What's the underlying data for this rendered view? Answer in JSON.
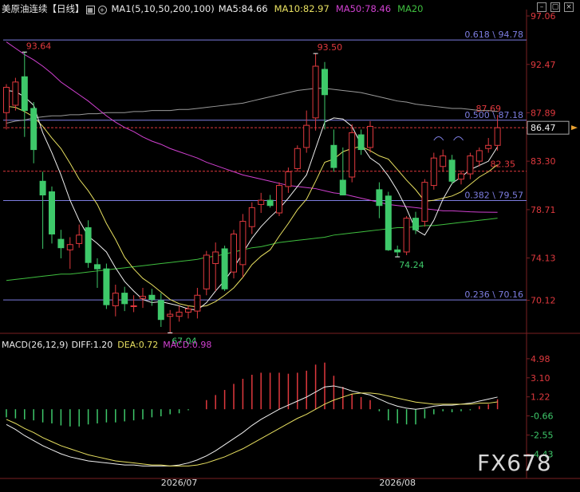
{
  "header": {
    "instrument": "美原油连续",
    "period": "【日线】",
    "ma_params": "MA1(5,10,50,200,100)",
    "ma5": "MA5:84.66",
    "ma10": "MA10:82.97",
    "ma50": "MA50:78.46",
    "ma20": "MA20"
  },
  "macd_header": {
    "name": "MACD(26,12,9)",
    "diff": "DIFF:1.20",
    "dea": "DEA:0.72",
    "macd": "MACD:0.98"
  },
  "colors": {
    "up": "#e0393e",
    "down": "#3ec96a",
    "ma5": "#f0f0f0",
    "ma10": "#e8e060",
    "ma50": "#d040d0",
    "ma20": "#3fbf3f",
    "ma200": "#9a9a9a",
    "fib": "#7d7de0",
    "ref": "#e0393e"
  },
  "watermark": "FX678",
  "chart_data": [
    {
      "type": "candlestick",
      "ylim": [
        67.9,
        97.06
      ],
      "price_ticks": [
        "97.06",
        "92.47",
        "87.89",
        "83.30",
        "78.71",
        "74.13",
        "70.12"
      ],
      "price_tick_values": [
        97.06,
        92.47,
        87.89,
        83.3,
        78.71,
        74.13,
        70.12
      ],
      "current_price": "86.47",
      "current_price_value": 86.47,
      "x_labels": [
        {
          "label": "2026/07",
          "index": 19
        },
        {
          "label": "2026/08",
          "index": 43
        }
      ],
      "fib_levels": [
        {
          "label": "0.618 \\ 94.78",
          "value": 94.78
        },
        {
          "label": "0.500 \\ 87.18",
          "value": 87.18
        },
        {
          "label": "0.382 \\ 79.57",
          "value": 79.57
        },
        {
          "label": "0.236 \\ 70.16",
          "value": 70.16
        }
      ],
      "ref_lines": [
        {
          "label": "87.69",
          "value": 86.47
        },
        {
          "label": "82.35",
          "value": 82.35
        }
      ],
      "annotations": [
        {
          "text": "93.64",
          "index": 2,
          "value": 93.64,
          "pos": "above"
        },
        {
          "text": "93.50",
          "index": 34,
          "value": 93.5,
          "pos": "above"
        },
        {
          "text": "67.04",
          "index": 18,
          "value": 67.04,
          "pos": "below"
        },
        {
          "text": "74.24",
          "index": 43,
          "value": 74.24,
          "pos": "below"
        }
      ],
      "candles": [
        {
          "o": 87.9,
          "h": 90.6,
          "l": 86.3,
          "c": 90.3
        },
        {
          "o": 88.6,
          "h": 91.2,
          "l": 88.1,
          "c": 90.8
        },
        {
          "o": 91.3,
          "h": 93.64,
          "l": 85.6,
          "c": 88.1
        },
        {
          "o": 88.3,
          "h": 88.9,
          "l": 83.1,
          "c": 84.4
        },
        {
          "o": 81.4,
          "h": 82.3,
          "l": 75.0,
          "c": 80.1
        },
        {
          "o": 80.4,
          "h": 80.9,
          "l": 75.5,
          "c": 76.4
        },
        {
          "o": 75.9,
          "h": 76.8,
          "l": 74.1,
          "c": 75.1
        },
        {
          "o": 74.9,
          "h": 76.1,
          "l": 73.1,
          "c": 75.4
        },
        {
          "o": 75.5,
          "h": 77.3,
          "l": 75.1,
          "c": 76.3
        },
        {
          "o": 77.0,
          "h": 77.7,
          "l": 73.2,
          "c": 73.7
        },
        {
          "o": 73.5,
          "h": 74.1,
          "l": 71.3,
          "c": 73.1
        },
        {
          "o": 73.1,
          "h": 73.6,
          "l": 69.3,
          "c": 69.7
        },
        {
          "o": 69.6,
          "h": 71.6,
          "l": 68.6,
          "c": 70.8
        },
        {
          "o": 70.8,
          "h": 71.4,
          "l": 69.1,
          "c": 69.8
        },
        {
          "o": 69.6,
          "h": 70.6,
          "l": 69.0,
          "c": 69.6
        },
        {
          "o": 70.3,
          "h": 71.3,
          "l": 69.4,
          "c": 70.5
        },
        {
          "o": 70.6,
          "h": 71.2,
          "l": 69.6,
          "c": 70.2
        },
        {
          "o": 70.1,
          "h": 70.8,
          "l": 67.6,
          "c": 68.3
        },
        {
          "o": 68.6,
          "h": 69.2,
          "l": 67.04,
          "c": 68.8
        },
        {
          "o": 68.6,
          "h": 69.6,
          "l": 68.1,
          "c": 69.0
        },
        {
          "o": 69.0,
          "h": 69.6,
          "l": 68.4,
          "c": 69.3
        },
        {
          "o": 69.1,
          "h": 71.3,
          "l": 68.4,
          "c": 70.6
        },
        {
          "o": 71.2,
          "h": 74.8,
          "l": 70.6,
          "c": 74.4
        },
        {
          "o": 73.6,
          "h": 75.6,
          "l": 71.0,
          "c": 74.7
        },
        {
          "o": 75.0,
          "h": 75.3,
          "l": 71.0,
          "c": 71.2
        },
        {
          "o": 72.8,
          "h": 76.8,
          "l": 72.2,
          "c": 76.4
        },
        {
          "o": 73.5,
          "h": 78.3,
          "l": 72.3,
          "c": 77.6
        },
        {
          "o": 77.1,
          "h": 79.4,
          "l": 76.4,
          "c": 78.9
        },
        {
          "o": 79.2,
          "h": 80.3,
          "l": 78.4,
          "c": 79.6
        },
        {
          "o": 79.6,
          "h": 80.1,
          "l": 78.9,
          "c": 79.1
        },
        {
          "o": 78.4,
          "h": 81.3,
          "l": 78.1,
          "c": 81.0
        },
        {
          "o": 80.9,
          "h": 82.7,
          "l": 80.3,
          "c": 82.3
        },
        {
          "o": 82.6,
          "h": 84.8,
          "l": 82.3,
          "c": 84.5
        },
        {
          "o": 84.6,
          "h": 88.1,
          "l": 84.1,
          "c": 86.7
        },
        {
          "o": 87.4,
          "h": 93.5,
          "l": 86.2,
          "c": 92.3
        },
        {
          "o": 92.0,
          "h": 92.7,
          "l": 86.3,
          "c": 89.6
        },
        {
          "o": 84.8,
          "h": 86.3,
          "l": 82.3,
          "c": 82.7
        },
        {
          "o": 81.5,
          "h": 84.6,
          "l": 80.2,
          "c": 80.1
        },
        {
          "o": 81.8,
          "h": 86.8,
          "l": 81.3,
          "c": 86.0
        },
        {
          "o": 85.8,
          "h": 86.3,
          "l": 83.9,
          "c": 84.4
        },
        {
          "o": 84.6,
          "h": 87.1,
          "l": 84.1,
          "c": 86.6
        },
        {
          "o": 80.6,
          "h": 81.3,
          "l": 77.9,
          "c": 79.1
        },
        {
          "o": 80.0,
          "h": 80.4,
          "l": 74.8,
          "c": 74.9
        },
        {
          "o": 74.9,
          "h": 75.3,
          "l": 74.24,
          "c": 74.7
        },
        {
          "o": 74.7,
          "h": 78.1,
          "l": 74.4,
          "c": 77.9
        },
        {
          "o": 77.9,
          "h": 78.5,
          "l": 76.4,
          "c": 76.8
        },
        {
          "o": 77.6,
          "h": 81.6,
          "l": 77.1,
          "c": 81.3
        },
        {
          "o": 81.0,
          "h": 84.1,
          "l": 80.6,
          "c": 83.6
        },
        {
          "o": 82.8,
          "h": 84.4,
          "l": 82.3,
          "c": 83.8
        },
        {
          "o": 83.4,
          "h": 83.9,
          "l": 81.1,
          "c": 81.4
        },
        {
          "o": 81.6,
          "h": 82.4,
          "l": 81.1,
          "c": 82.1
        },
        {
          "o": 82.1,
          "h": 84.1,
          "l": 81.6,
          "c": 83.8
        },
        {
          "o": 83.3,
          "h": 84.6,
          "l": 82.8,
          "c": 84.3
        },
        {
          "o": 84.5,
          "h": 85.5,
          "l": 84.1,
          "c": 84.8
        },
        {
          "o": 84.8,
          "h": 87.69,
          "l": 84.3,
          "c": 86.47
        }
      ],
      "ma5": [
        90.0,
        89.9,
        89.4,
        88.6,
        86.0,
        84.1,
        82.0,
        79.6,
        77.7,
        76.2,
        75.5,
        74.7,
        73.2,
        71.9,
        71.0,
        70.2,
        69.9,
        70.0,
        69.8,
        69.6,
        69.3,
        69.2,
        69.9,
        71.0,
        72.0,
        73.2,
        74.6,
        76.0,
        77.1,
        78.0,
        78.8,
        79.8,
        80.9,
        82.0,
        84.5,
        87.0,
        87.4,
        87.3,
        86.6,
        84.9,
        83.6,
        83.0,
        81.9,
        80.5,
        78.8,
        76.8,
        76.3,
        77.7,
        79.7,
        81.2,
        81.8,
        82.5,
        82.9,
        83.3,
        84.66
      ],
      "ma10": [
        88.5,
        88.4,
        88.0,
        87.5,
        86.6,
        85.5,
        84.5,
        83.1,
        81.6,
        80.5,
        79.2,
        77.4,
        75.9,
        74.2,
        73.1,
        72.2,
        71.6,
        70.9,
        70.2,
        69.8,
        69.6,
        69.5,
        69.6,
        70.0,
        70.6,
        71.3,
        72.3,
        73.5,
        74.3,
        74.9,
        76.2,
        77.4,
        78.7,
        79.7,
        81.4,
        83.2,
        83.5,
        84.2,
        84.5,
        84.7,
        84.3,
        83.8,
        83.5,
        82.5,
        81.5,
        80.6,
        79.5,
        79.6,
        79.8,
        80.0,
        80.4,
        81.1,
        81.8,
        82.3,
        82.97
      ],
      "ma50": [
        94.6,
        94.0,
        93.4,
        92.9,
        92.3,
        91.6,
        90.8,
        90.2,
        89.6,
        89.0,
        88.3,
        87.6,
        87.0,
        86.5,
        86.1,
        85.6,
        85.2,
        84.9,
        84.5,
        84.2,
        83.9,
        83.6,
        83.2,
        82.9,
        82.6,
        82.3,
        82.0,
        81.8,
        81.6,
        81.4,
        81.2,
        81.0,
        80.9,
        80.8,
        80.7,
        80.5,
        80.3,
        80.2,
        80.0,
        79.8,
        79.6,
        79.4,
        79.2,
        79.1,
        79.0,
        78.9,
        78.8,
        78.7,
        78.6,
        78.6,
        78.55,
        78.5,
        78.48,
        78.47,
        78.46
      ],
      "ma20": [
        72.0,
        72.1,
        72.2,
        72.3,
        72.4,
        72.5,
        72.6,
        72.6,
        72.7,
        72.8,
        72.9,
        73.0,
        73.1,
        73.2,
        73.3,
        73.4,
        73.5,
        73.6,
        73.7,
        73.8,
        73.9,
        74.0,
        74.2,
        74.3,
        74.5,
        74.7,
        74.9,
        75.1,
        75.2,
        75.4,
        75.6,
        75.7,
        75.8,
        75.9,
        76.0,
        76.1,
        76.3,
        76.4,
        76.5,
        76.6,
        76.7,
        76.8,
        76.9,
        77.0,
        77.0,
        77.1,
        77.2,
        77.2,
        77.3,
        77.4,
        77.5,
        77.6,
        77.7,
        77.8,
        77.9
      ],
      "ma200": [
        86.9,
        87.1,
        87.2,
        87.4,
        87.5,
        87.6,
        87.6,
        87.7,
        87.7,
        87.8,
        87.8,
        87.9,
        87.9,
        87.9,
        88.0,
        88.0,
        88.1,
        88.1,
        88.1,
        88.2,
        88.2,
        88.3,
        88.4,
        88.5,
        88.6,
        88.7,
        88.8,
        89.0,
        89.2,
        89.4,
        89.6,
        89.8,
        90.0,
        90.1,
        90.2,
        90.2,
        90.1,
        90.0,
        89.9,
        89.8,
        89.6,
        89.4,
        89.2,
        89.0,
        88.9,
        88.7,
        88.6,
        88.5,
        88.4,
        88.3,
        88.3,
        88.2,
        88.1,
        88.1,
        88.0
      ]
    },
    {
      "type": "bar",
      "title": "MACD(26,12,9)",
      "ylim": [
        -6.2,
        5.6
      ],
      "ticks": [
        "4.98",
        "3.10",
        "1.22",
        "-0.66",
        "-2.55",
        "-4.43"
      ],
      "tick_values": [
        4.98,
        3.1,
        1.22,
        -0.66,
        -2.55,
        -4.43
      ],
      "macd": [
        -0.8,
        -0.9,
        -1.0,
        -1.1,
        -1.3,
        -1.4,
        -1.6,
        -1.7,
        -1.7,
        -1.5,
        -1.4,
        -1.3,
        -1.3,
        -1.2,
        -1.1,
        -1.0,
        -0.8,
        -0.7,
        -0.5,
        -0.4,
        -0.1,
        0.0,
        0.9,
        1.4,
        1.9,
        2.5,
        3.0,
        3.4,
        3.6,
        3.6,
        3.6,
        3.5,
        3.6,
        3.8,
        4.4,
        4.6,
        3.3,
        2.2,
        1.5,
        1.2,
        0.9,
        -0.2,
        -1.1,
        -1.4,
        -1.5,
        -1.5,
        -0.9,
        -0.5,
        -0.2,
        -0.3,
        -0.2,
        -0.1,
        0.3,
        0.5,
        0.98
      ],
      "diff": [
        -1.5,
        -2.0,
        -2.6,
        -3.1,
        -3.6,
        -4.0,
        -4.4,
        -4.7,
        -4.9,
        -5.1,
        -5.2,
        -5.3,
        -5.4,
        -5.5,
        -5.5,
        -5.6,
        -5.6,
        -5.6,
        -5.6,
        -5.5,
        -5.3,
        -5.0,
        -4.6,
        -4.1,
        -3.5,
        -2.9,
        -2.3,
        -1.6,
        -1.0,
        -0.5,
        0.0,
        0.4,
        0.8,
        1.2,
        1.7,
        2.2,
        2.3,
        2.1,
        1.8,
        1.6,
        1.4,
        1.0,
        0.6,
        0.3,
        0.1,
        0.0,
        0.1,
        0.3,
        0.4,
        0.4,
        0.5,
        0.6,
        0.8,
        1.0,
        1.2
      ],
      "dea": [
        -1.0,
        -1.4,
        -1.9,
        -2.3,
        -2.8,
        -3.2,
        -3.6,
        -3.9,
        -4.2,
        -4.5,
        -4.7,
        -4.9,
        -5.1,
        -5.2,
        -5.3,
        -5.4,
        -5.5,
        -5.5,
        -5.6,
        -5.6,
        -5.6,
        -5.5,
        -5.3,
        -5.0,
        -4.7,
        -4.3,
        -3.9,
        -3.4,
        -2.9,
        -2.4,
        -1.9,
        -1.4,
        -0.9,
        -0.5,
        0.0,
        0.5,
        0.9,
        1.2,
        1.5,
        1.6,
        1.6,
        1.5,
        1.3,
        1.1,
        0.9,
        0.7,
        0.6,
        0.5,
        0.5,
        0.5,
        0.5,
        0.5,
        0.6,
        0.6,
        0.72
      ]
    }
  ]
}
